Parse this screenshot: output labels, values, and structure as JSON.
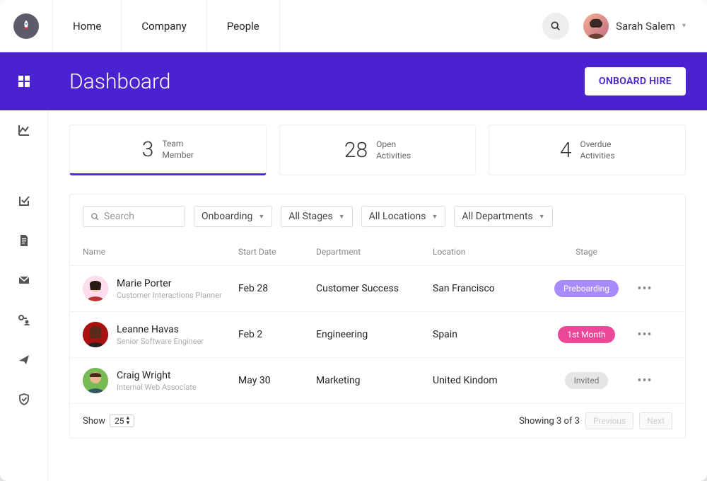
{
  "nav": {
    "items": [
      "Home",
      "Company",
      "People"
    ]
  },
  "user": {
    "name": "Sarah Salem"
  },
  "search": {
    "placeholder": "Search"
  },
  "banner": {
    "title": "Dashboard",
    "cta": "ONBOARD HIRE"
  },
  "stats": [
    {
      "value": "3",
      "l1": "Team",
      "l2": "Member"
    },
    {
      "value": "28",
      "l1": "Open",
      "l2": "Activities"
    },
    {
      "value": "4",
      "l1": "Overdue",
      "l2": "Activities"
    }
  ],
  "filters": {
    "status": "Onboarding",
    "stages": "All Stages",
    "locations": "All Locations",
    "departments": "All Departments"
  },
  "table": {
    "headers": {
      "name": "Name",
      "start": "Start Date",
      "dept": "Department",
      "loc": "Location",
      "stage": "Stage"
    },
    "rows": [
      {
        "name": "Marie Porter",
        "role": "Customer Interactions Planner",
        "start": "Feb 28",
        "dept": "Customer Success",
        "loc": "San Francisco",
        "stage": "Preboarding",
        "stage_class": "b-purple"
      },
      {
        "name": "Leanne Havas",
        "role": "Senior Software Engineer",
        "start": "Feb 2",
        "dept": "Engineering",
        "loc": "Spain",
        "stage": "1st Month",
        "stage_class": "b-pink"
      },
      {
        "name": "Craig Wright",
        "role": "Internal Web Associate",
        "start": "May 30",
        "dept": "Marketing",
        "loc": "United Kindom",
        "stage": "Invited",
        "stage_class": "b-grey"
      }
    ]
  },
  "footer": {
    "show_label": "Show",
    "page_size": "25",
    "showing": "Showing 3 of 3",
    "prev": "Previous",
    "next": "Next"
  }
}
